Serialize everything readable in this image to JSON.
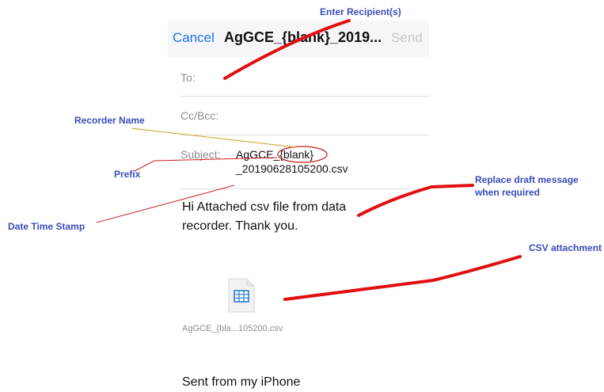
{
  "compose": {
    "cancel_label": "Cancel",
    "title": "AgGCE_{blank}_2019...",
    "send_label": "Send",
    "to_label": "To:",
    "ccbcc_label": "Cc/Bcc:",
    "subject_label": "Subject:",
    "subject_line1": "AgGCE_{blank}",
    "subject_line2": "_20190628105200.csv",
    "body_line1": "Hi Attached csv file from data",
    "body_line2": "recorder. Thank you.",
    "attachment_name": "AgGCE_{bla...105200.csv",
    "signature": "Sent from my iPhone"
  },
  "annotations": {
    "enter_recipients": "Enter Recipient(s)",
    "recorder_name": "Recorder Name",
    "prefix": "Prefix",
    "date_time_stamp": "Date Time Stamp",
    "replace_draft_line1": "Replace draft message",
    "replace_draft_line2": "when required",
    "csv_attachment": "CSV attachment"
  },
  "colors": {
    "accent": "#1a73e8",
    "annotation_text": "#3a4cb8",
    "marker_red": "#e01010"
  },
  "icons": {
    "attachment": "spreadsheet-file-icon"
  }
}
